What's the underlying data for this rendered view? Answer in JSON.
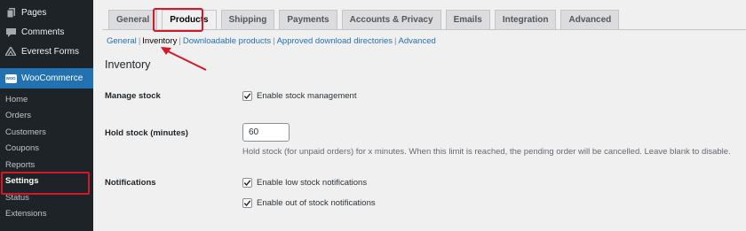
{
  "sidebar": {
    "menu": [
      {
        "label": "Pages",
        "icon": "pages-icon"
      },
      {
        "label": "Comments",
        "icon": "comments-icon"
      },
      {
        "label": "Everest Forms",
        "icon": "everest-forms-icon"
      },
      {
        "label": "WooCommerce",
        "icon": "woocommerce-icon",
        "badge": "WOO"
      }
    ],
    "submenu": [
      "Home",
      "Orders",
      "Customers",
      "Coupons",
      "Reports",
      "Settings",
      "Status",
      "Extensions"
    ]
  },
  "tabs": [
    "General",
    "Products",
    "Shipping",
    "Payments",
    "Accounts & Privacy",
    "Emails",
    "Integration",
    "Advanced"
  ],
  "subnav": {
    "general": "General",
    "inventory": "Inventory",
    "downloadable": "Downloadable products",
    "approved": "Approved download directories",
    "advanced": "Advanced",
    "separator": "|"
  },
  "section_title": "Inventory",
  "fields": {
    "manage_stock": {
      "label": "Manage stock",
      "checkbox_label": "Enable stock management",
      "checked": true
    },
    "hold_stock": {
      "label": "Hold stock (minutes)",
      "value": "60",
      "description": "Hold stock (for unpaid orders) for x minutes. When this limit is reached, the pending order will be cancelled. Leave blank to disable."
    },
    "notifications": {
      "label": "Notifications",
      "low_stock": "Enable low stock notifications",
      "out_of_stock": "Enable out of stock notifications"
    }
  },
  "colors": {
    "accent": "#2271b1",
    "highlight": "#d3182a",
    "sidebar_bg": "#1d2327"
  }
}
